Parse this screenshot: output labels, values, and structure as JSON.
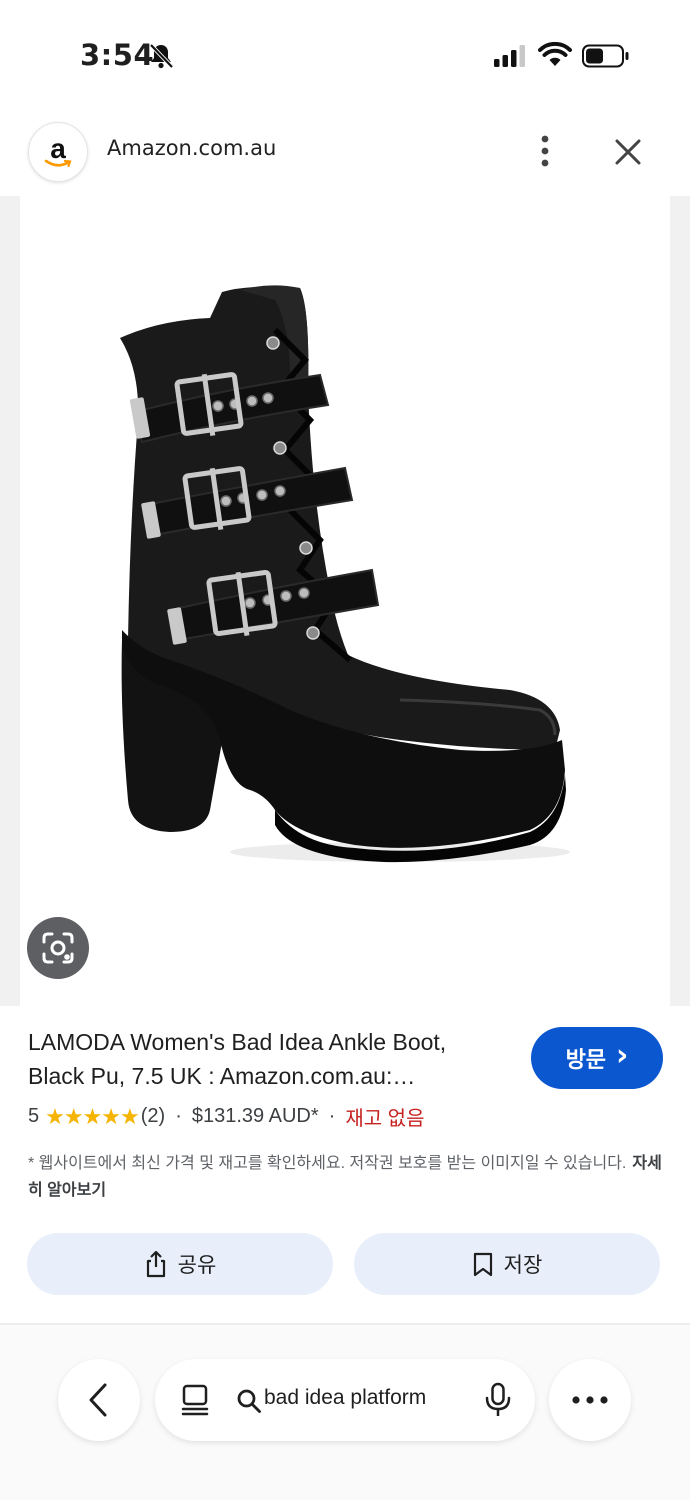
{
  "status_bar": {
    "time": "3:54"
  },
  "site": {
    "logo_letter": "a",
    "name": "Amazon.com.au"
  },
  "product": {
    "title_line1": "LAMODA Women's Bad Idea Ankle Boot,",
    "title_line2": "Black Pu, 7.5 UK : Amazon.com.au:…",
    "rating": "5",
    "stars": "★★★★★",
    "rating_value": 5,
    "review_count": "(2)",
    "separator": "·",
    "price": "$131.39 AUD*",
    "stock_status": "재고 없음",
    "stock_color": "#c5221f"
  },
  "visit_button": {
    "label": "방문",
    "chevron": "›"
  },
  "disclaimer": {
    "text": "* 웹사이트에서 최신 가격 및 재고를 확인하세요. 저작권 보호를 받는 이미지일 수 있습니다.",
    "more_link": "자세히 알아보기"
  },
  "actions": {
    "share_label": "공유",
    "save_label": "저장"
  },
  "bottom_bar": {
    "search_query": "bad idea platform"
  },
  "colors": {
    "accent": "#0b57d0",
    "pill_bg": "#e8effb",
    "star": "#f4b400"
  },
  "icons": [
    "bell-off-icon",
    "signal-icon",
    "wifi-icon",
    "battery-icon",
    "more-vert-icon",
    "close-icon",
    "lens-icon",
    "share-icon",
    "bookmark-icon",
    "back-arrow-icon",
    "tabs-icon",
    "search-icon",
    "mic-icon",
    "more-horiz-icon"
  ]
}
